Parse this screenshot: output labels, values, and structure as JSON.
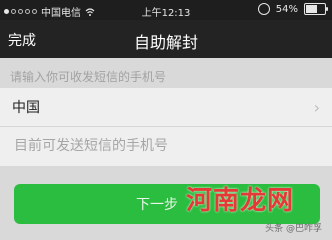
{
  "status_bar": {
    "carrier": "中国电信",
    "time": "上午12:13",
    "battery": "54%",
    "battery_fraction": 0.54,
    "signal_icon": "signal-dots-icon",
    "wifi_icon": "wifi-icon",
    "rotation_icon": "rotation-lock-icon",
    "battery_icon": "battery-icon"
  },
  "nav": {
    "done_label": "完成",
    "title": "自助解封"
  },
  "form": {
    "hint": "请输入你可收发短信的手机号",
    "country_value": "中国",
    "chevron_icon": "chevron-right-icon",
    "phone_placeholder": "目前可发送短信的手机号"
  },
  "primary_button": {
    "label": "下一步",
    "color": "#2bbd3f"
  },
  "watermark": {
    "text": "河南龙网",
    "sub_text": "头条 @巴咋孚"
  },
  "colors": {
    "background": "#d9d9d9",
    "nav_background": "#232323",
    "accent_green": "#2bbd3f",
    "watermark_red": "#e53935"
  }
}
